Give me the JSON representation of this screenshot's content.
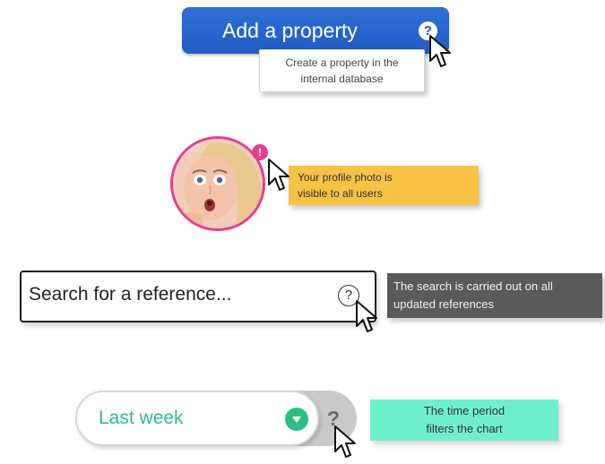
{
  "property_button": {
    "label": "Add a property",
    "help_glyph": "?",
    "tooltip_line1": "Create a property in the",
    "tooltip_line2": "internal database",
    "color": "#1f5cc4"
  },
  "profile": {
    "avatar_icon": "profile-photo",
    "badge_glyph": "!",
    "tooltip_line1": "Your profile photo is",
    "tooltip_line2": "visible to all users",
    "accent": "#e63c92",
    "tooltip_color": "#f8c244"
  },
  "search": {
    "placeholder": "Search for a reference...",
    "help_glyph": "?",
    "tooltip_line1": "The search is carried out on all",
    "tooltip_line2": "updated references",
    "tooltip_color": "#5a5a5a"
  },
  "period_select": {
    "value": "Last week",
    "chevron_icon": "chevron-down-icon",
    "help_glyph": "?",
    "tooltip_line1": "The time period",
    "tooltip_line2": "filters the chart",
    "accent": "#2cbd86",
    "tooltip_color": "#6ff0cc"
  }
}
